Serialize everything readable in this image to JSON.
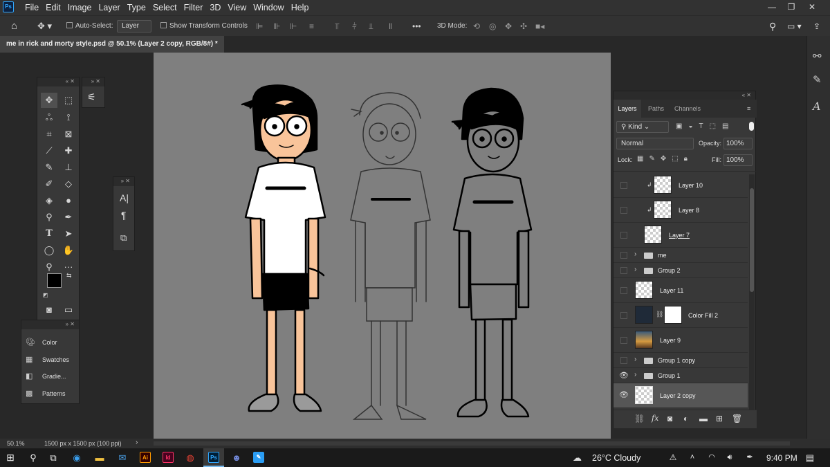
{
  "app": {
    "logo": "Ps"
  },
  "menu": [
    "File",
    "Edit",
    "Image",
    "Layer",
    "Type",
    "Select",
    "Filter",
    "3D",
    "View",
    "Window",
    "Help"
  ],
  "window_controls": {
    "minimize": "—",
    "restore": "❐",
    "close": "✕"
  },
  "options": {
    "auto_select_label": "Auto-Select:",
    "auto_select_value": "Layer",
    "transform_label": "Show Transform Controls",
    "mode3d_label": "3D Mode:",
    "more": "•••"
  },
  "document": {
    "tab_title": "me in rick and morty style.psd @ 50.1% (Layer 2 copy, RGB/8#) *",
    "close": "×"
  },
  "tool_colors": {
    "foreground": "#000000",
    "background": "#f9c49a"
  },
  "libraries": [
    "Color",
    "Swatches",
    "Gradie...",
    "Patterns"
  ],
  "layers_panel": {
    "tabs": [
      "Layers",
      "Paths",
      "Channels"
    ],
    "kind_label": "Kind",
    "blend_mode": "Normal",
    "opacity_label": "Opacity:",
    "opacity_value": "100%",
    "lock_label": "Lock:",
    "fill_label": "Fill:",
    "fill_value": "100%",
    "layers": [
      {
        "name": "Layer 10",
        "visible": false
      },
      {
        "name": "Layer 8",
        "visible": false
      },
      {
        "name": "Layer 7",
        "visible": false
      },
      {
        "name": "me",
        "visible": false
      },
      {
        "name": "Group 2",
        "visible": false
      },
      {
        "name": "Layer 11",
        "visible": false
      },
      {
        "name": "Color Fill 2",
        "visible": false
      },
      {
        "name": "Layer 9",
        "visible": false
      },
      {
        "name": "Group 1 copy",
        "visible": false
      },
      {
        "name": "Group 1",
        "visible": true
      },
      {
        "name": "Layer 2 copy",
        "visible": true
      }
    ]
  },
  "status": {
    "zoom": "50.1%",
    "doc_info": "1500 px x 1500 px (100 ppi)"
  },
  "taskbar": {
    "weather": "26°C  Cloudy",
    "time": "9:40 PM"
  }
}
